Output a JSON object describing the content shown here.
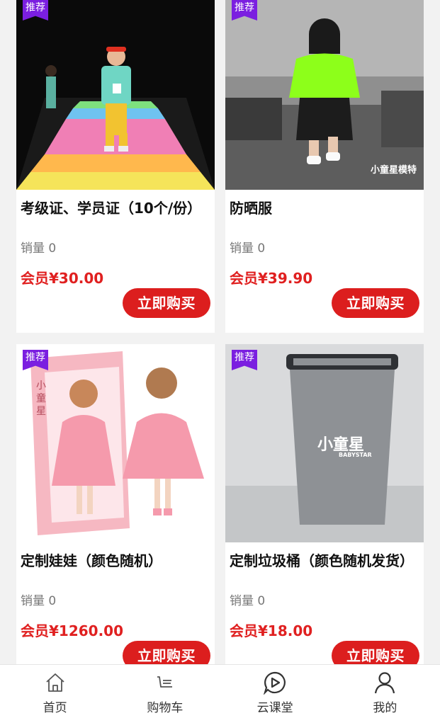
{
  "products": [
    {
      "badge": "推荐",
      "title": "考级证、学员证（10个/份）",
      "sales": "销量 0",
      "price": "会员¥30.00",
      "buy": "立即购买",
      "image": "kid-runway-photo"
    },
    {
      "badge": "推荐",
      "title": "防晒服",
      "sales": "销量 0",
      "price": "会员¥39.90",
      "buy": "立即购买",
      "image": "kid-green-jacket-photo",
      "watermark": "小童星模特"
    },
    {
      "badge": "推荐",
      "title": "定制娃娃（颜色随机）",
      "sales": "销量 0",
      "price": "会员¥1260.00",
      "buy": "立即购买",
      "image": "doll-box-photo",
      "box_text": "小童星"
    },
    {
      "badge": "推荐",
      "title": "定制垃圾桶（颜色随机发货）",
      "sales": "销量 0",
      "price": "会员¥18.00",
      "buy": "立即购买",
      "image": "trash-bin-photo",
      "logo": "小童星",
      "logo_sub": "BABYSTAR"
    }
  ],
  "tabbar": [
    {
      "label": "首页",
      "icon": "home-icon"
    },
    {
      "label": "购物车",
      "icon": "cart-icon"
    },
    {
      "label": "云课堂",
      "icon": "play-icon"
    },
    {
      "label": "我的",
      "icon": "user-icon"
    }
  ],
  "colors": {
    "accent": "#dc1e1e",
    "badge": "#7b1fe0",
    "price": "#e02020"
  }
}
